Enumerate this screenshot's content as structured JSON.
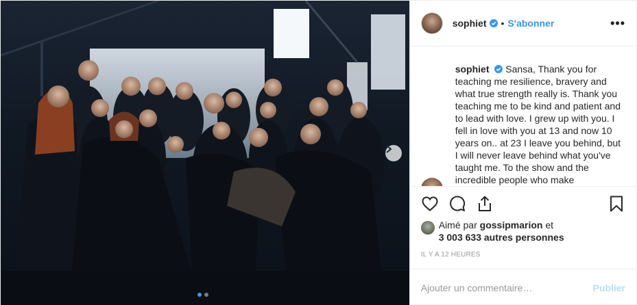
{
  "post": {
    "username": "sophiet",
    "separator": "•",
    "follow_label": "S'abonner",
    "more_label": "•••",
    "caption_text": "Sansa, Thank you for teaching me resilience, bravery and what true strength really is. Thank you teaching me to be kind and patient and to lead with love. I grew up with you. I fell in love with you at 13 and now 10 years on.. at 23 I leave you behind, but I will never leave behind what you've taught me. To the show and the incredible people who make",
    "likes_prefix": "Aimé par",
    "likes_user": "gossipmarion",
    "likes_conjunction": "et",
    "likes_count": "3 003 633 autres personnes",
    "timestamp": "IL Y A 12 HEURES",
    "comment_placeholder": "Ajouter un commentaire…",
    "publish_label": "Publier"
  },
  "carousel": {
    "total": 2,
    "active_index": 0
  },
  "colors": {
    "link_blue": "#3897f0",
    "publish_disabled": "#b2dffc",
    "text": "#262626",
    "muted": "#999999",
    "border": "#efefef"
  },
  "icons": [
    "verified-badge-icon",
    "more-options-icon",
    "heart-icon",
    "comment-icon",
    "share-icon",
    "bookmark-icon",
    "chevron-right-icon"
  ]
}
